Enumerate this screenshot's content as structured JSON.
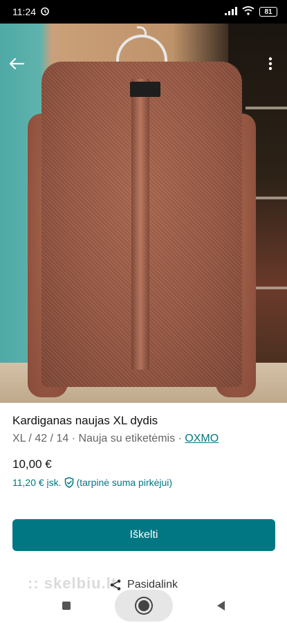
{
  "status_bar": {
    "time": "11:24",
    "battery": "81",
    "icons": [
      "alarm-icon",
      "signal-icon",
      "wifi-icon",
      "battery-icon"
    ]
  },
  "gallery": {
    "icons": {
      "back": "arrow-left-icon",
      "more": "more-vertical-icon"
    },
    "dots_total": 5,
    "active_index": 0
  },
  "item": {
    "title": "Kardiganas naujas XL dydis",
    "meta_prefix": "XL / 42 / 14 · Nauja su etiketėmis · ",
    "brand": "OXMO",
    "price": "10,00 €",
    "price_incl": "11,20 € įsk.",
    "price_incl_note": "(tarpinė suma pirkėjui)"
  },
  "actions": {
    "primary": "Iškelti",
    "share": "Pasidalink"
  },
  "colors": {
    "accent": "#007782"
  }
}
